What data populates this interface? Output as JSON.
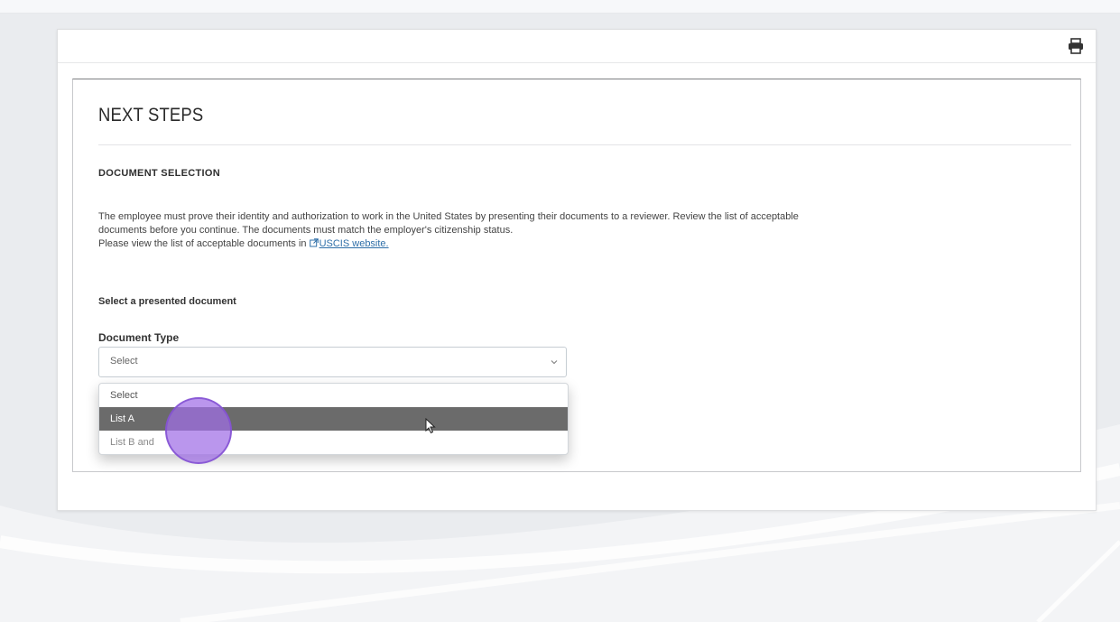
{
  "page": {
    "title": "NEXT STEPS",
    "section_heading": "DOCUMENT SELECTION",
    "description_lines": [
      "The employee must prove their identity and authorization to work in the United States by presenting their documents to a reviewer. Review the list of acceptable",
      "documents before you continue. The documents must match the employer's citizenship status."
    ],
    "view_prefix": "Please view the list of acceptable documents in ",
    "link_text": "USCIS website.",
    "select_heading": "Select a presented document",
    "field_label": "Document Type"
  },
  "select": {
    "value": "Select",
    "options": [
      "Select",
      "List A",
      "List B and"
    ],
    "highlighted_index": 1
  },
  "icons": {
    "print": "printer-icon",
    "external": "external-link-icon",
    "chevron": "chevron-down-icon"
  },
  "colors": {
    "link": "#2f6fa8",
    "highlight": "#6b6b6b",
    "click_indicator": "#a06ee6"
  }
}
